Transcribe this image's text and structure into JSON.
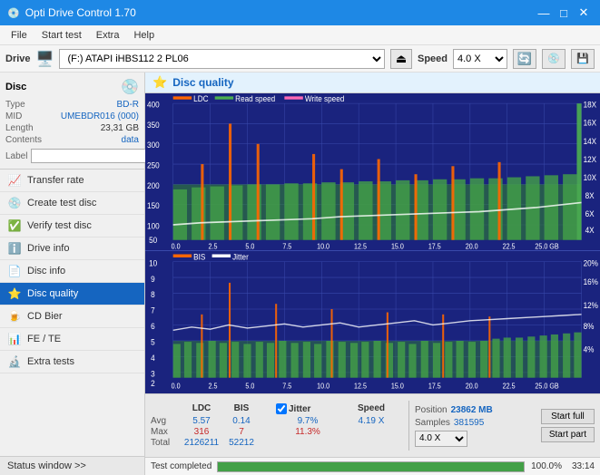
{
  "app": {
    "title": "Opti Drive Control 1.70",
    "icon": "💿"
  },
  "title_controls": {
    "minimize": "—",
    "maximize": "□",
    "close": "✕"
  },
  "menu": {
    "items": [
      "File",
      "Start test",
      "Extra",
      "Help"
    ]
  },
  "drive_bar": {
    "label": "Drive",
    "drive_value": "(F:) ATAPI iHBS112  2 PL06",
    "eject_icon": "⏏",
    "speed_label": "Speed",
    "speed_value": "4.0 X",
    "icon1": "🔄",
    "icon2": "💾",
    "icon3": "📋"
  },
  "disc": {
    "title": "Disc",
    "icon": "💿",
    "type_label": "Type",
    "type_value": "BD-R",
    "mid_label": "MID",
    "mid_value": "UMEBDR016 (000)",
    "length_label": "Length",
    "length_value": "23,31 GB",
    "contents_label": "Contents",
    "contents_value": "data",
    "label_label": "Label",
    "label_value": "",
    "label_placeholder": ""
  },
  "nav": {
    "items": [
      {
        "id": "transfer-rate",
        "label": "Transfer rate",
        "icon": "📈"
      },
      {
        "id": "create-test-disc",
        "label": "Create test disc",
        "icon": "💿"
      },
      {
        "id": "verify-test-disc",
        "label": "Verify test disc",
        "icon": "✅"
      },
      {
        "id": "drive-info",
        "label": "Drive info",
        "icon": "ℹ️"
      },
      {
        "id": "disc-info",
        "label": "Disc info",
        "icon": "📄"
      },
      {
        "id": "disc-quality",
        "label": "Disc quality",
        "icon": "⭐",
        "active": true
      },
      {
        "id": "cd-bier",
        "label": "CD Bier",
        "icon": "🍺"
      },
      {
        "id": "fe-te",
        "label": "FE / TE",
        "icon": "📊"
      },
      {
        "id": "extra-tests",
        "label": "Extra tests",
        "icon": "🔬"
      }
    ]
  },
  "sidebar_status": "Status window >>",
  "chart": {
    "title": "Disc quality",
    "icon": "⭐",
    "top_legend": [
      {
        "label": "LDC",
        "color": "#ff6600"
      },
      {
        "label": "Read speed",
        "color": "#4caf50"
      },
      {
        "label": "Write speed",
        "color": "#ff69b4"
      }
    ],
    "bottom_legend": [
      {
        "label": "BIS",
        "color": "#ff6600"
      },
      {
        "label": "Jitter",
        "color": "#ffffff"
      }
    ],
    "top_y_left_max": "400",
    "top_y_right_max": "18X",
    "bottom_y_left_max": "10",
    "bottom_y_right_max": "20%",
    "x_labels": [
      "0.0",
      "2.5",
      "5.0",
      "7.5",
      "10.0",
      "12.5",
      "15.0",
      "17.5",
      "20.0",
      "22.5",
      "25.0 GB"
    ]
  },
  "stats": {
    "headers": [
      "",
      "LDC",
      "BIS",
      "",
      "Jitter",
      "Speed"
    ],
    "avg_label": "Avg",
    "avg_ldc": "5.57",
    "avg_bis": "0.14",
    "avg_jitter": "9.7%",
    "avg_speed": "4.19 X",
    "max_label": "Max",
    "max_ldc": "316",
    "max_bis": "7",
    "max_jitter": "11.3%",
    "total_label": "Total",
    "total_ldc": "2126211",
    "total_bis": "52212",
    "position_label": "Position",
    "position_value": "23862 MB",
    "samples_label": "Samples",
    "samples_value": "381595",
    "speed_select": "4.0 X",
    "start_full_label": "Start full",
    "start_part_label": "Start part",
    "jitter_checked": true
  },
  "progress": {
    "percent": "100.0%",
    "fill": 100,
    "time": "33:14",
    "status": "Test completed"
  },
  "colors": {
    "accent": "#1565c0",
    "chart_bg": "#1a237e",
    "grid": "#3949ab",
    "ldc_color": "#ff6600",
    "read_speed_color": "#4caf50",
    "jitter_color": "#ffffff",
    "bis_color": "#ff6600",
    "bar_green": "#43a047"
  }
}
